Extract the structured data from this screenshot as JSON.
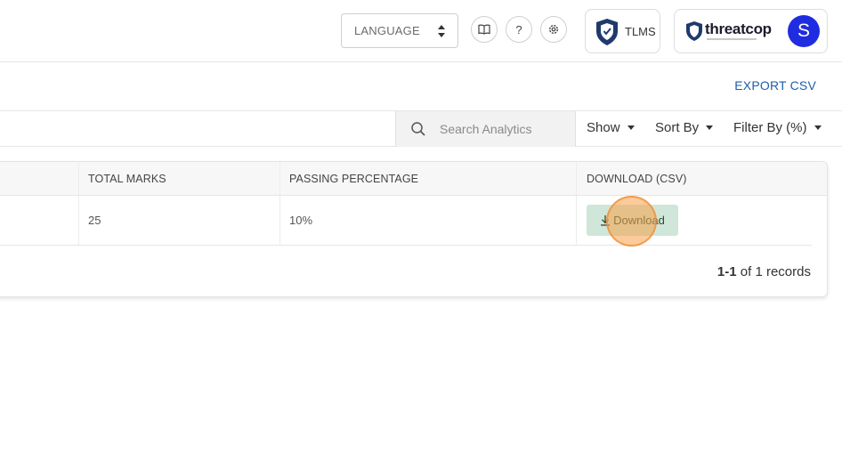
{
  "header": {
    "language_label": "LANGUAGE",
    "book_icon": "book-icon",
    "help_glyph": "?",
    "settings_icon": "gear-icon",
    "tlms_label": "TLMS",
    "brand_name": "threatcop",
    "avatar_initial": "S"
  },
  "toolbar": {
    "export_label": "EXPORT CSV"
  },
  "filters": {
    "search_placeholder": "Search Analytics",
    "show_label": "Show",
    "sort_label": "Sort By",
    "filter_label": "Filter By (%)"
  },
  "table": {
    "columns": [
      "TOTAL MARKS",
      "PASSING PERCENTAGE",
      "DOWNLOAD (CSV)"
    ],
    "rows": [
      {
        "total_marks": "25",
        "passing_percentage": "10%",
        "download_label": "Download"
      }
    ],
    "records_range": "1-1",
    "records_suffix": "of 1 records"
  },
  "colors": {
    "accent": "#1d5fa8",
    "avatar": "#1f2ce0",
    "download_button": "#cfe6d8",
    "click_highlight": "#f7a048"
  }
}
